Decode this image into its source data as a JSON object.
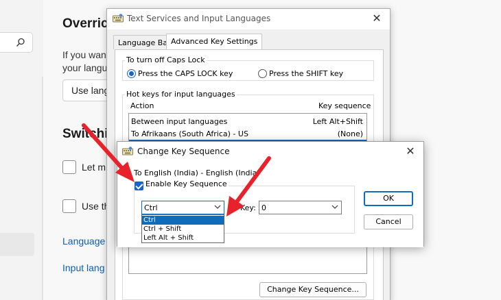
{
  "background": {
    "title": "Overric",
    "desc_line1": "If you wan",
    "desc_line2": "your langu",
    "select_label": "Use lang",
    "heading2": "Switchi",
    "check1_label": "Let m",
    "check2_label": "Use th",
    "link1": "Language",
    "link2": "Input lang"
  },
  "text_services": {
    "title": "Text Services and Input Languages",
    "tabs": [
      {
        "label": "Language Bar"
      },
      {
        "label": "Advanced Key Settings"
      }
    ],
    "caps_group_label": "To turn off Caps Lock",
    "caps_options": [
      {
        "label": "Press the CAPS LOCK key",
        "selected": true
      },
      {
        "label": "Press the SHIFT key",
        "selected": false
      }
    ],
    "hotkeys_group_label": "Hot keys for input languages",
    "col_action": "Action",
    "col_key": "Key sequence",
    "rows": [
      {
        "action": "Between input languages",
        "key": "Left Alt+Shift"
      },
      {
        "action": "To Afrikaans (South Africa) - US",
        "key": "(None)"
      }
    ],
    "change_button": "Change Key Sequence..."
  },
  "change_key": {
    "title": "Change Key Sequence",
    "target": "To English (India) - English (India)",
    "enable_label": "Enable Key Sequence",
    "enable_checked": true,
    "modifier_value": "Ctrl",
    "key_label": "Key:",
    "key_value": "0",
    "ok": "OK",
    "cancel": "Cancel",
    "dropdown_options": [
      "Ctrl",
      "Ctrl + Shift",
      "Left Alt + Shift"
    ],
    "dropdown_selected_index": 0
  },
  "colors": {
    "accent": "#0f6cbd",
    "arrow": "#e8222a",
    "link": "#0a5fb4"
  }
}
